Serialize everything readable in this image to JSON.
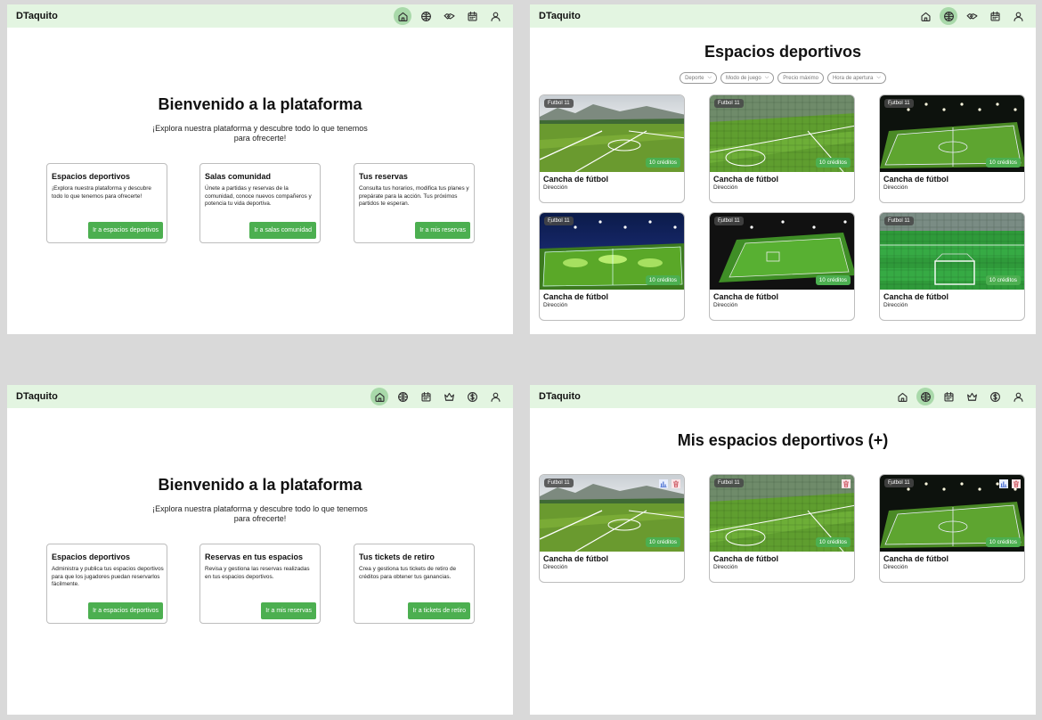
{
  "brand": "DTaquito",
  "colors": {
    "accent": "#4caf50",
    "topbar": "#e3f5e1",
    "active_nav": "#a9d9aa",
    "delete": "#c94b56",
    "stats": "#4a6fd1"
  },
  "screen1": {
    "nav_icons": [
      "home-icon",
      "globe-icon",
      "handshake-icon",
      "calendar-icon",
      "user-icon"
    ],
    "active_nav": "home-icon",
    "title": "Bienvenido a la plataforma",
    "subtitle": "¡Explora nuestra plataforma y descubre todo lo que tenemos para ofrecerte!",
    "cards": [
      {
        "title": "Espacios deportivos",
        "desc": "¡Explora nuestra plataforma y descubre todo lo que tenemos para ofrecerte!",
        "button": "Ir a espacios deportivos"
      },
      {
        "title": "Salas comunidad",
        "desc": "Únete a partidas y reservas de la comunidad, conoce nuevos compañeros y potencia tu vida deportiva.",
        "button": "Ir a salas comunidad"
      },
      {
        "title": "Tus reservas",
        "desc": "Consulta tus horarios, modifica tus planes y prepárate para la acción. Tus próximos partidos te esperan.",
        "button": "Ir a mis reservas"
      }
    ]
  },
  "screen2": {
    "nav_icons": [
      "home-icon",
      "globe-icon",
      "handshake-icon",
      "calendar-icon",
      "user-icon"
    ],
    "active_nav": "globe-icon",
    "title": "Espacios deportivos",
    "filters": [
      "Deporte",
      "Modo de juego",
      "Precio máximo",
      "Hora de apertura"
    ],
    "spaces": [
      {
        "tag": "Futbol 11",
        "name": "Cancha de fútbol",
        "address": "Dirección",
        "credits": "10 créditos",
        "image": "daylight-pitch"
      },
      {
        "tag": "Futbol 11",
        "name": "Cancha de fútbol",
        "address": "Dirección",
        "credits": "10 créditos",
        "image": "caged-pitch"
      },
      {
        "tag": "Futbol 11",
        "name": "Cancha de fútbol",
        "address": "Dirección",
        "credits": "10 créditos",
        "image": "night-pitch"
      },
      {
        "tag": "Futbol 11",
        "name": "Cancha de fútbol",
        "address": "Dirección",
        "credits": "10 créditos",
        "image": "lit-pitch"
      },
      {
        "tag": "Futbol 11",
        "name": "Cancha de fútbol",
        "address": "Dirección",
        "credits": "10 créditos",
        "image": "dark-pitch"
      },
      {
        "tag": "Futbol 11",
        "name": "Cancha de fútbol",
        "address": "Dirección",
        "credits": "10 créditos",
        "image": "goal-pitch"
      }
    ]
  },
  "screen3": {
    "nav_icons": [
      "home-icon",
      "globe-icon",
      "calendar-icon",
      "crown-icon",
      "dollar-icon",
      "user-icon"
    ],
    "active_nav": "home-icon",
    "title": "Bienvenido a la plataforma",
    "subtitle": "¡Explora nuestra plataforma y descubre todo lo que tenemos para ofrecerte!",
    "cards": [
      {
        "title": "Espacios deportivos",
        "desc": "Administra y publica tus espacios deportivos para que los jugadores puedan reservarlos fácilmente.",
        "button": "Ir a espacios deportivos"
      },
      {
        "title": "Reservas en tus espacios",
        "desc": "Revisa y gestiona las reservas realizadas en tus espacios deportivos.",
        "button": "Ir a mis reservas"
      },
      {
        "title": "Tus tickets de retiro",
        "desc": "Crea y gestiona tus tickets de retiro de créditos para obtener tus ganancias.",
        "button": "Ir a tickets de retiro"
      }
    ]
  },
  "screen4": {
    "nav_icons": [
      "home-icon",
      "globe-icon",
      "calendar-icon",
      "crown-icon",
      "dollar-icon",
      "user-icon"
    ],
    "active_nav": "globe-icon",
    "title": "Mis espacios deportivos (+)",
    "spaces": [
      {
        "tag": "Futbol 11",
        "name": "Cancha de fútbol",
        "address": "Dirección",
        "credits": "10 créditos",
        "image": "daylight-pitch",
        "actions": [
          "stats-icon",
          "trash-icon"
        ]
      },
      {
        "tag": "Futbol 11",
        "name": "Cancha de fútbol",
        "address": "Dirección",
        "credits": "10 créditos",
        "image": "caged-pitch",
        "actions": [
          "trash-icon"
        ]
      },
      {
        "tag": "Futbol 11",
        "name": "Cancha de fútbol",
        "address": "Dirección",
        "credits": "10 créditos",
        "image": "night-pitch",
        "actions": [
          "stats-icon",
          "trash-icon"
        ]
      }
    ]
  }
}
